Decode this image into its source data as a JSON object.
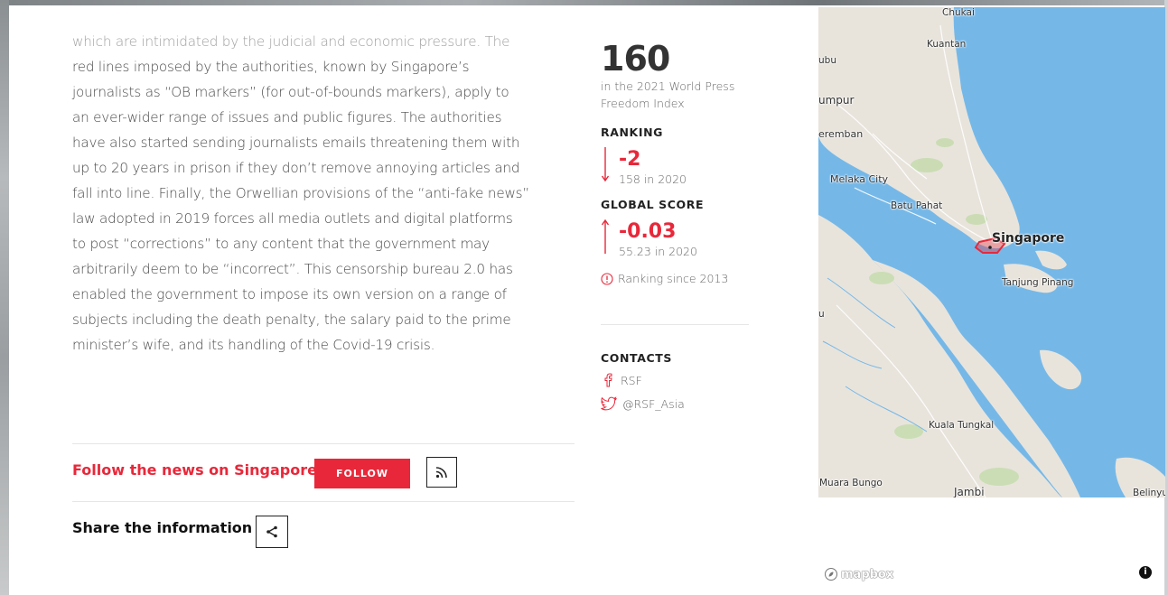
{
  "article": {
    "lines": [
      "which are intimidated by the judicial and economic pressure. The",
      "red lines imposed by the authorities, known by Singapore’s",
      "journalists as “OB markers” (for out-of-bounds markers), apply to",
      "an ever-wider range of issues and public figures. The authorities",
      "have also started sending journalists emails threatening them with",
      "up to 20 years in prison if they don’t remove annoying articles and",
      "fall into line. Finally, the Orwellian provisions of the “anti-fake news”",
      "law adopted in 2019 forces all media outlets and digital platforms",
      "to post “corrections” to any content that the government may",
      "arbitrarily deem to be “incorrect”. This censorship bureau 2.0 has",
      "enabled the government to impose its own version on a range of",
      "subjects including the death penalty, the salary paid to the prime",
      "minister’s wife, and its handling of the Covid-19 crisis."
    ]
  },
  "follow": {
    "title": "Follow the news on Singapore",
    "button": "FOLLOW",
    "rss_icon": "rss-icon"
  },
  "share": {
    "title": "Share the information",
    "icon": "share-icon"
  },
  "stats": {
    "rank": "160",
    "rank_sub_1": "in the 2021 World Press",
    "rank_sub_2": "Freedom Index",
    "ranking_label": "RANKING",
    "ranking_delta": "-2",
    "ranking_prev": "158 in 2020",
    "score_label": "GLOBAL SCORE",
    "score_delta": "-0.03",
    "score_prev": "55.23 in 2020",
    "since": "Ranking since 2013",
    "accent": "#e8283a"
  },
  "contacts": {
    "label": "CONTACTS",
    "facebook": "RSF",
    "twitter": "@RSF_Asia"
  },
  "map": {
    "labels": {
      "chukai": "Chukai",
      "kuantan": "Kuantan",
      "kubu": "ubu",
      "lumpur": "umpur",
      "seremban": "eremban",
      "melaka": "Melaka City",
      "batu_pahat": "Batu Pahat",
      "singapore": "Singapore",
      "tanjung_pinang": "Tanjung Pinang",
      "u": "u",
      "kuala_tungkal": "Kuala Tungkal",
      "muara_bungo": "Muara Bungo",
      "jambi": "Jambi",
      "belinyu": "Belinyu"
    },
    "attribution": "mapbox",
    "info": "i",
    "water_color": "#75b8e8",
    "land_color": "#e8e4dc",
    "highlight_color": "#e8283a"
  }
}
